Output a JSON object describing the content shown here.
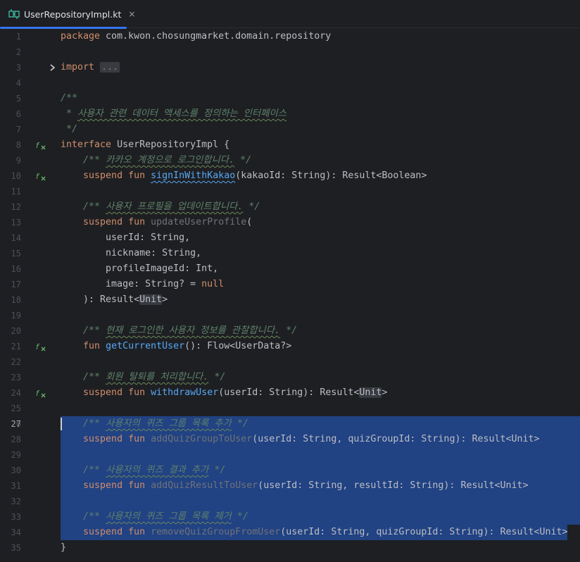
{
  "tab": {
    "label": "UserRepositoryImpl.kt",
    "close": "×",
    "icon": "kotlin-interface-file-icon"
  },
  "colors": {
    "background": "#1e1f22",
    "keyword": "#cf8e6d",
    "function": "#56a8f5",
    "comment": "#5f826b",
    "selection": "#214283",
    "tab_underline": "#3574f0"
  },
  "editor": {
    "current_line": "27",
    "lines": [
      {
        "n": "1"
      },
      {
        "n": "2"
      },
      {
        "n": "3"
      },
      {
        "n": "4"
      },
      {
        "n": "5"
      },
      {
        "n": "6"
      },
      {
        "n": "7"
      },
      {
        "n": "8"
      },
      {
        "n": "9"
      },
      {
        "n": "10"
      },
      {
        "n": "11"
      },
      {
        "n": "12"
      },
      {
        "n": "13"
      },
      {
        "n": "14"
      },
      {
        "n": "15"
      },
      {
        "n": "16"
      },
      {
        "n": "17"
      },
      {
        "n": "18"
      },
      {
        "n": "19"
      },
      {
        "n": "20"
      },
      {
        "n": "21"
      },
      {
        "n": "22"
      },
      {
        "n": "23"
      },
      {
        "n": "24"
      },
      {
        "n": "25"
      },
      {
        "n": "26"
      },
      {
        "n": "27"
      },
      {
        "n": "28"
      },
      {
        "n": "29"
      },
      {
        "n": "30"
      },
      {
        "n": "31"
      },
      {
        "n": "32"
      },
      {
        "n": "33"
      },
      {
        "n": "34"
      },
      {
        "n": "35"
      }
    ],
    "code": {
      "kw_package": "package",
      "package_name": " com.kwon.chosungmarket.domain.repository",
      "kw_import": "import",
      "import_fold": "...",
      "doc_open": "/**",
      "doc_line_prefix": " * ",
      "doc_line_text": "사용자 관련 데이터 액세스를 정의하는 인터페이스",
      "doc_close": " */",
      "kw_interface": "interface",
      "interface_decl": " UserRepositoryImpl {",
      "c10_open": "/** ",
      "c10_text": "카카오 계정으로 로그인합니다.",
      "c_close": " */",
      "kw_suspend": "suspend",
      "kw_fun": "fun",
      "fn_signIn": "signInWithKakao",
      "sig_signIn": "(kakaoId: String): Result<Boolean>",
      "c13_text": "사용자 프로필을 업데이트합니다.",
      "fn_update": "updateUserProfile",
      "paren_open": "(",
      "p_userId": "userId: String,",
      "p_nickname": "nickname: String,",
      "p_profileImageId": "profileImageId: Int,",
      "p_image_a": "image: String? = ",
      "kw_null": "null",
      "ret_update_a": "): Result<",
      "ret_update_unit": "Unit",
      "ret_update_b": ">",
      "c21_text": "현재 로그인한 사용자 정보를 관찰합니다.",
      "fn_getCurrent": "getCurrentUser",
      "sig_getCurrent": "(): Flow<UserData?>",
      "c24_text": "회원 탈퇴를 처리합니다.",
      "fn_withdraw": "withdrawUser",
      "sig_withdraw_a": "(userId: String): Result<",
      "sig_withdraw_unit": "Unit",
      "sig_withdraw_b": ">",
      "c27_text": "사용자의 퀴즈 그룹 목록 추가",
      "fn_addGroup": "addQuizGroupToUser",
      "sig_addGroup": "(userId: String, quizGroupId: String): Result<Unit>",
      "c30_text": "사용자의 퀴즈 결과 추가",
      "fn_addResult": "addQuizResultToUser",
      "sig_addResult": "(userId: String, resultId: String): Result<Unit>",
      "c33_text": "사용자의 퀴즈 그룹 목록 제거",
      "fn_remove": "removeQuizGroupFromUser",
      "sig_remove": "(userId: String, quizGroupId: String): Result<Unit>",
      "close_brace": "}"
    }
  }
}
